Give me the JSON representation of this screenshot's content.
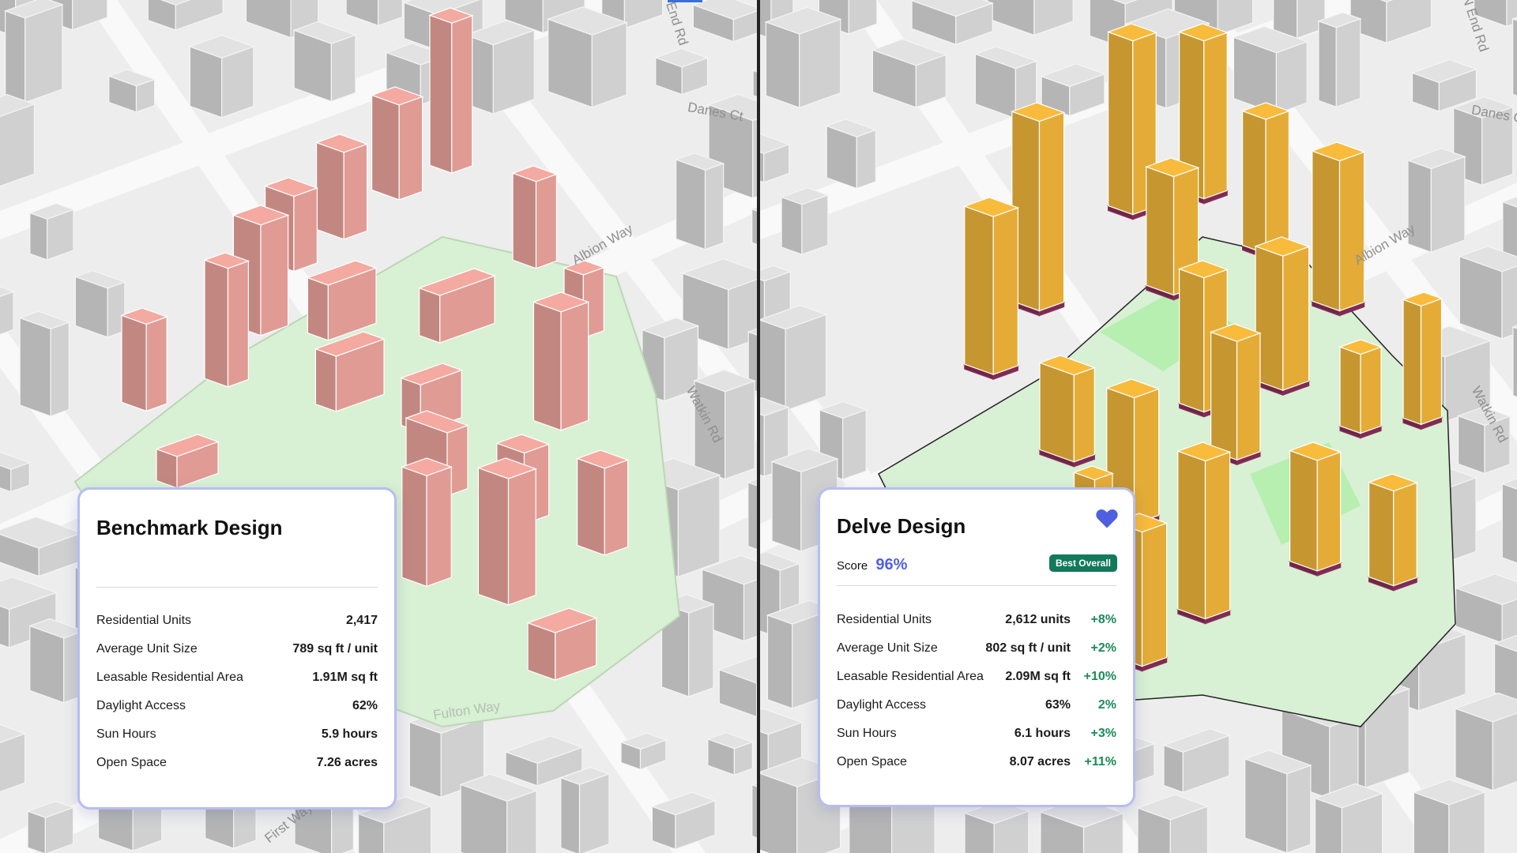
{
  "streets": {
    "left": [
      "End Rd",
      "Danes Ct",
      "Albion Way",
      "Watkin Rd",
      "Fulton Way",
      "First Way"
    ],
    "right": [
      "N End Rd",
      "Danes C",
      "Albion Way",
      "Watkin Rd"
    ]
  },
  "benchmark": {
    "title": "Benchmark Design",
    "metrics": [
      {
        "label": "Residential Units",
        "value": "2,417"
      },
      {
        "label": "Average Unit Size",
        "value": "789 sq ft / unit"
      },
      {
        "label": "Leasable Residential Area",
        "value": "1.91M sq ft"
      },
      {
        "label": "Daylight Access",
        "value": "62%"
      },
      {
        "label": "Sun Hours",
        "value": "5.9 hours"
      },
      {
        "label": "Open Space",
        "value": "7.26 acres"
      }
    ]
  },
  "delve": {
    "title": "Delve Design",
    "score_label": "Score",
    "score_value": "96%",
    "badge": "Best Overall",
    "favorite_icon": "heart-icon",
    "metrics": [
      {
        "label": "Residential Units",
        "value": "2,612 units",
        "delta": "+8%"
      },
      {
        "label": "Average Unit Size",
        "value": "802 sq ft / unit",
        "delta": "+2%"
      },
      {
        "label": "Leasable Residential Area",
        "value": "2.09M sq ft",
        "delta": "+10%"
      },
      {
        "label": "Daylight Access",
        "value": "63%",
        "delta": "2%"
      },
      {
        "label": "Sun Hours",
        "value": "6.1 hours",
        "delta": "+3%"
      },
      {
        "label": "Open Space",
        "value": "8.07 acres",
        "delta": "+11%"
      }
    ]
  },
  "colors": {
    "benchmark_mass": "#f4a9a1",
    "delve_mass": "#f8bb3c",
    "site_green": "#d8f0d4",
    "accent": "#4f5fe0",
    "positive_delta": "#1b8a5a",
    "badge_bg": "#13795b",
    "heart": "#4f5fe0"
  }
}
